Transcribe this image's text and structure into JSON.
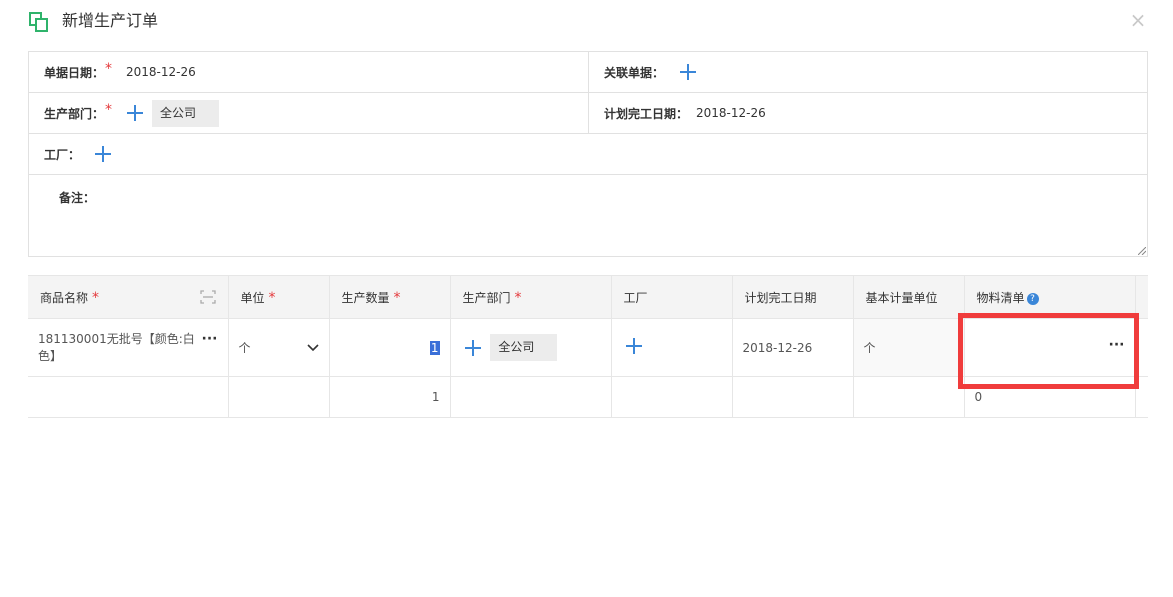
{
  "dialog": {
    "title": "新增生产订单",
    "close_symbol": "×"
  },
  "form": {
    "doc_date_label": "单据日期：",
    "doc_date_value": "2018-12-26",
    "related_doc_label": "关联单据：",
    "dept_label": "生产部门：",
    "dept_tag": "全公司",
    "plan_finish_label": "计划完工日期：",
    "plan_finish_value": "2018-12-26",
    "factory_label": "工厂：",
    "remark_label": "备注：",
    "required_mark": "*"
  },
  "grid": {
    "headers": {
      "product_name": "商品名称",
      "unit": "单位",
      "qty": "生产数量",
      "dept": "生产部门",
      "factory": "工厂",
      "plan_finish": "计划完工日期",
      "base_unit": "基本计量单位",
      "bom": "物料清单"
    },
    "row": {
      "product_name": "181130001无批号【颜色:白色】",
      "unit": "个",
      "qty": "1",
      "dept_tag": "全公司",
      "plan_finish": "2018-12-26",
      "base_unit": "个",
      "more": "···"
    },
    "summary": {
      "qty": "1",
      "bom": "0"
    }
  },
  "colors": {
    "accent": "#3a86d8",
    "required": "#e4393c",
    "highlight": "#f03c3c",
    "title_icon": "#2fb36b"
  }
}
